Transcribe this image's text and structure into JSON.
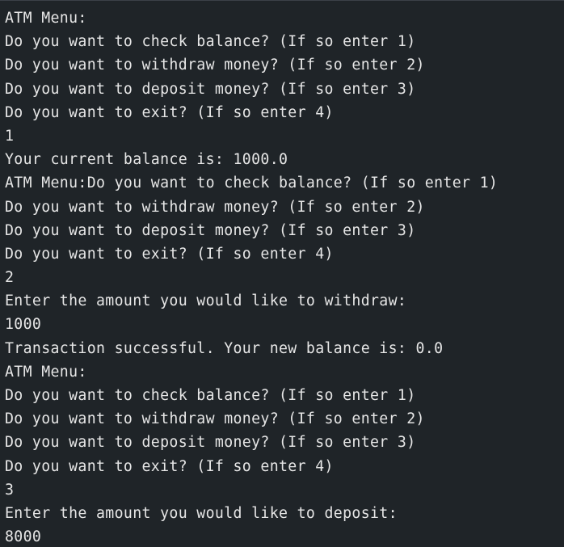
{
  "terminal": {
    "lines": [
      "ATM Menu:",
      "Do you want to check balance? (If so enter 1)",
      "Do you want to withdraw money? (If so enter 2)",
      "Do you want to deposit money? (If so enter 3)",
      "Do you want to exit? (If so enter 4)",
      "1",
      "Your current balance is: 1000.0",
      "ATM Menu:Do you want to check balance? (If so enter 1)",
      "Do you want to withdraw money? (If so enter 2)",
      "Do you want to deposit money? (If so enter 3)",
      "Do you want to exit? (If so enter 4)",
      "2",
      "Enter the amount you would like to withdraw:",
      "1000",
      "Transaction successful. Your new balance is: 0.0",
      "ATM Menu:",
      "Do you want to check balance? (If so enter 1)",
      "Do you want to withdraw money? (If so enter 2)",
      "Do you want to deposit money? (If so enter 3)",
      "Do you want to exit? (If so enter 4)",
      "3",
      "Enter the amount you would like to deposit:",
      "8000"
    ],
    "colors": {
      "background": "#1f2428",
      "text": "#e6e6e6"
    }
  }
}
